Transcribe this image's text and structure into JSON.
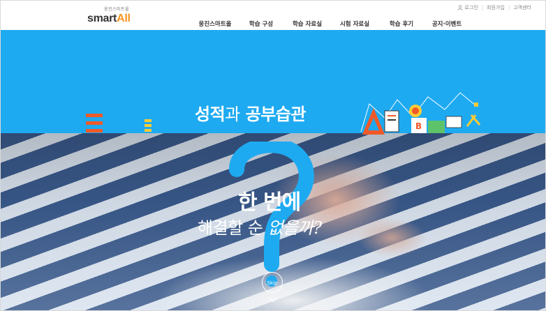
{
  "brand": {
    "sub": "웅진스마트올",
    "main_prefix": "smart",
    "main_accent": "All",
    "accent_color": "#f7931e"
  },
  "utility": {
    "login": "로그인",
    "signup": "회원가입",
    "support": "고객센터"
  },
  "nav": [
    {
      "label": "웅진스마트올"
    },
    {
      "label": "학습 구성"
    },
    {
      "label": "학습 자료실"
    },
    {
      "label": "시험 자료실"
    },
    {
      "label": "학습 후기"
    },
    {
      "label": "공지·이벤트"
    }
  ],
  "hero": {
    "headline_1": "성적",
    "headline_2": "과",
    "headline_3": "공부습관",
    "question_1": "한 번에",
    "question_2a": "해결할 순",
    "question_2b": "없을까?",
    "skip_label": "Skip",
    "background_color": "#1eaaf1"
  },
  "icons": [
    "person-icon",
    "question-mark-icon",
    "chevron-down-icon",
    "school-supplies-icon"
  ]
}
